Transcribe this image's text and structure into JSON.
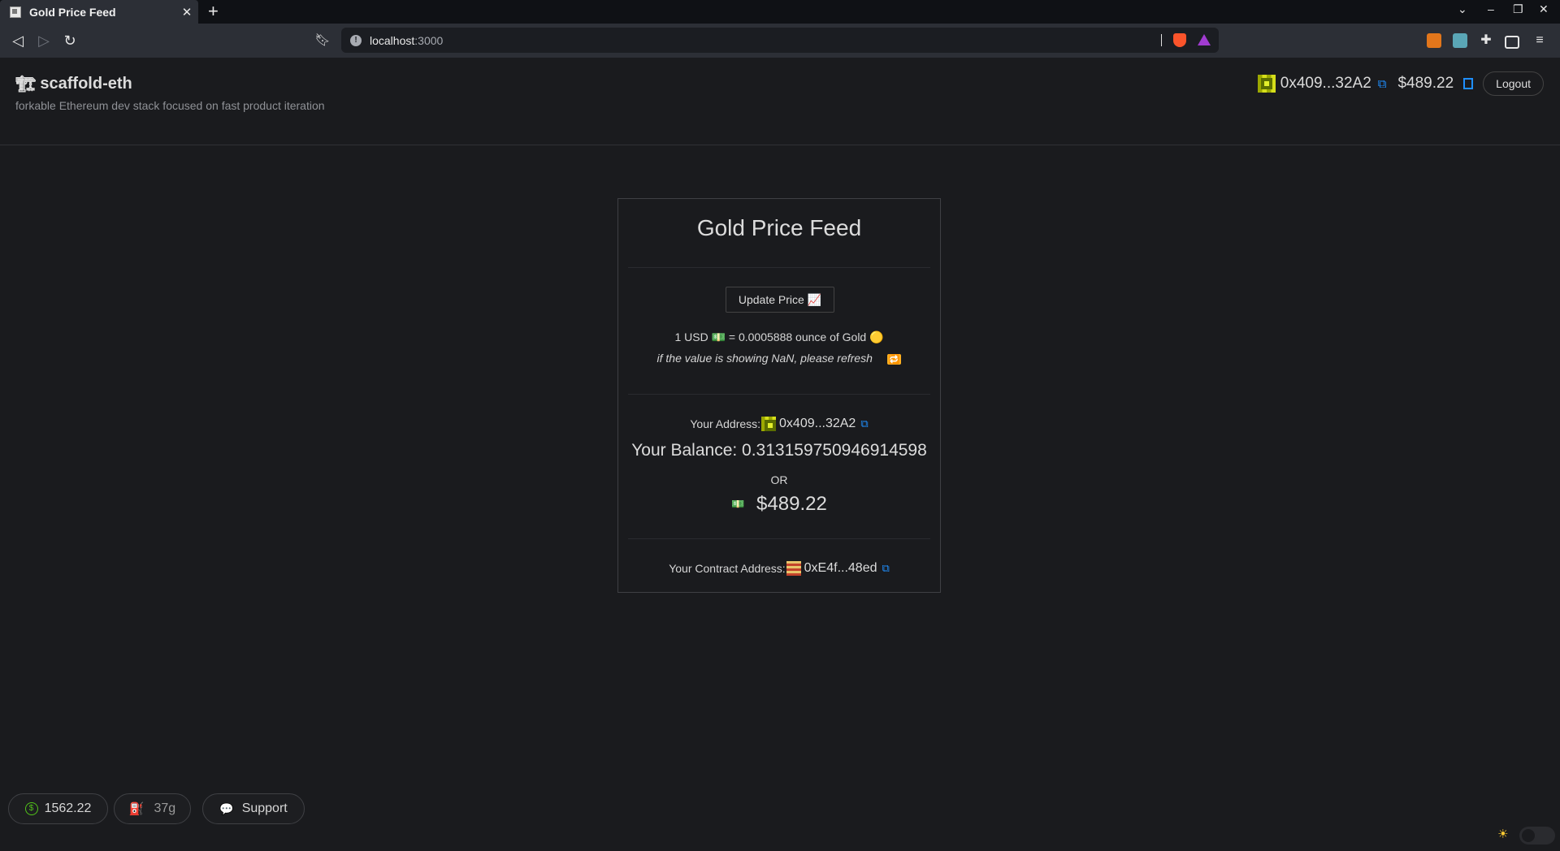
{
  "browser": {
    "tab_title": "Gold Price Feed",
    "tab_close": "✕",
    "new_tab": "+",
    "url_host": "localhost",
    "url_port": ":3000"
  },
  "header": {
    "brand_title": "scaffold-eth",
    "brand_subtitle": "forkable Ethereum dev stack focused on fast product iteration",
    "account_address": "0x409...32A2",
    "account_balance": "$489.22",
    "logout_label": "Logout"
  },
  "card": {
    "title": "Gold Price Feed",
    "update_button": "Update Price 📈",
    "price_usd": "1 USD",
    "price_rest": "= 0.0005888 ounce of Gold",
    "refresh_hint": "if the value is showing NaN, please refresh",
    "address_label": "Your Address:",
    "address_value": "0x409...32A2",
    "balance_text": "Your Balance: 0.313159750946914598",
    "or_text": "OR",
    "usd_value": "$489.22",
    "contract_label": "Your Contract Address:",
    "contract_value": "0xE4f...48ed"
  },
  "footer": {
    "eth_price": "1562.22",
    "gas_price": "37g",
    "support_label": "Support"
  },
  "icons": {
    "crane": "🏗",
    "copy": "⧉",
    "money": "💵",
    "gold": "🟡",
    "refresh": "🔁",
    "chat": "💬",
    "gas": "⛽",
    "sun": "☀"
  },
  "colors": {
    "background": "#1a1b1e",
    "accent": "#1f8fff",
    "border": "#3f4044",
    "price_green": "#52c41a"
  }
}
